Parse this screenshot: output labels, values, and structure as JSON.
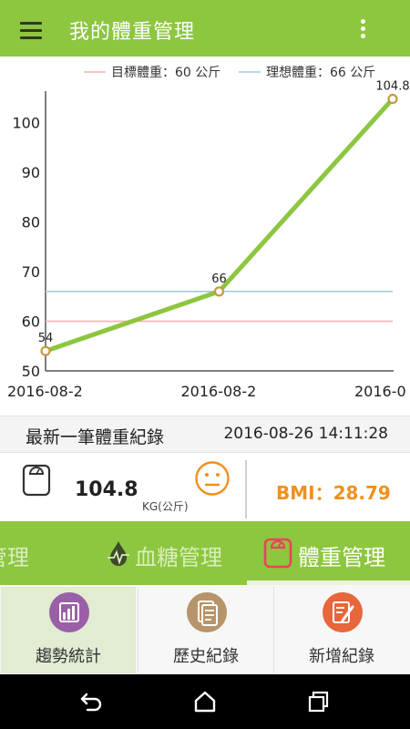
{
  "app_bar": {
    "title": "我的體重管理",
    "menu_icon": "hamburger-menu-icon",
    "overflow_icon": "more-vertical-icon"
  },
  "chart_data": {
    "type": "line",
    "x": [
      "2016-08-2",
      "2016-08-2",
      "2016-0"
    ],
    "values": [
      54,
      66,
      104.8
    ],
    "data_labels": [
      "54",
      "66",
      "104.8"
    ],
    "ylim": [
      50,
      106
    ],
    "yticks": [
      50,
      60,
      70,
      80,
      90,
      100
    ],
    "reference_lines": [
      {
        "name": "目標體重：60 公斤",
        "value": 60,
        "color": "#f3b3b3"
      },
      {
        "name": "理想體重：66 公斤",
        "value": 66,
        "color": "#a8c8e8"
      }
    ],
    "series_color": "#8dc63f",
    "marker_color": "#c69a3f",
    "legend_position": "top-right",
    "grid": false
  },
  "summary": {
    "title": "最新一筆體重紀錄",
    "timestamp": "2016-08-26 14:11:28",
    "weight": "104.8",
    "unit": "KG(公斤)",
    "bmi": "BMI：28.79",
    "status_icon": "neutral-face-icon",
    "scale_icon": "bathroom-scale-icon"
  },
  "tabs": [
    {
      "label": "壓管理",
      "active": false
    },
    {
      "label": "血糖管理",
      "icon": "blood-drop-icon",
      "active": false
    },
    {
      "label": "體重管理",
      "icon": "scale-icon",
      "active": true
    }
  ],
  "sub_nav": [
    {
      "label": "趨勢統計",
      "icon": "bar-chart-icon",
      "color": "#9b5fa8",
      "active": true
    },
    {
      "label": "歷史紀錄",
      "icon": "document-list-icon",
      "color": "#b7956a",
      "active": false
    },
    {
      "label": "新增紀錄",
      "icon": "edit-document-icon",
      "color": "#e8663c",
      "active": false
    }
  ],
  "colors": {
    "primary": "#8dc63f",
    "accent_orange": "#f0901e",
    "white": "#ffffff"
  },
  "system_nav": {
    "back_icon": "back-icon",
    "home_icon": "home-icon",
    "recents_icon": "recents-icon"
  }
}
